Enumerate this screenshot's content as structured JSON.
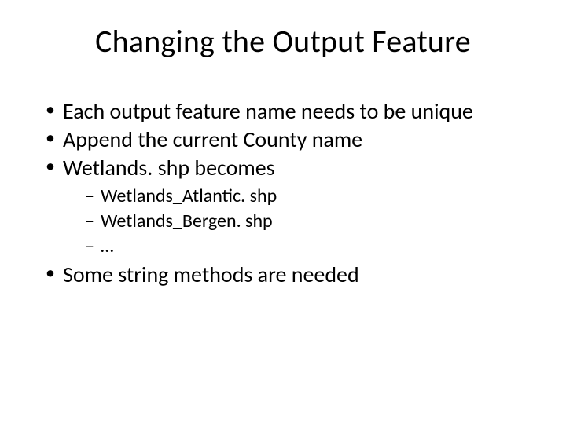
{
  "title": "Changing the Output Feature",
  "bullets": [
    {
      "text": "Each output feature name needs to be unique"
    },
    {
      "text": "Append the current County name"
    },
    {
      "text": "Wetlands. shp becomes",
      "sub": [
        "Wetlands_Atlantic. shp",
        "Wetlands_Bergen. shp",
        "…"
      ]
    },
    {
      "text": "Some string methods are needed"
    }
  ]
}
